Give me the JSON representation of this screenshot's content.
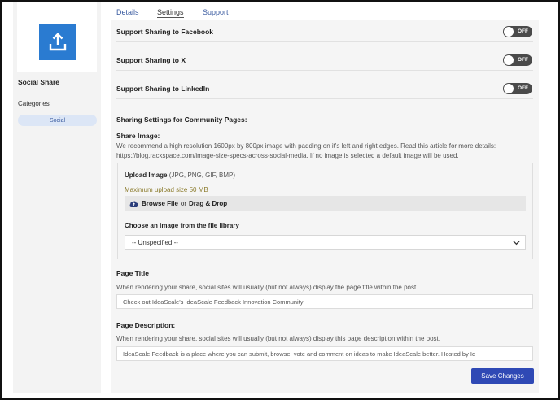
{
  "app": {
    "name": "Social Share",
    "icon": "share-upload-icon",
    "icon_color": "#2a7bd1",
    "categories_label": "Categories",
    "category_chip": "Social"
  },
  "tabs": [
    {
      "label": "Details",
      "active": false
    },
    {
      "label": "Settings",
      "active": true
    },
    {
      "label": "Support",
      "active": false
    }
  ],
  "toggles": [
    {
      "label": "Support Sharing to Facebook",
      "state": "OFF"
    },
    {
      "label": "Support Sharing to X",
      "state": "OFF"
    },
    {
      "label": "Support Sharing to LinkedIn",
      "state": "OFF"
    }
  ],
  "community": {
    "title": "Sharing Settings for Community Pages:",
    "share_image_title": "Share Image:",
    "share_image_desc_1": "We recommend a high resolution 1600px by 800px image with padding on it's left and right edges. Read this article for more details:",
    "share_image_desc_2": "https://blog.rackspace.com/image-size-specs-across-social-media. If no image is selected a default image will be used."
  },
  "upload": {
    "title": "Upload Image",
    "formats": "(JPG, PNG, GIF, BMP)",
    "max_size": "Maximum upload size 50 MB",
    "browse": "Browse File",
    "or": "or",
    "drag_drop": "Drag & Drop",
    "library_label": "Choose an image from the file library",
    "library_selected": "-- Unspecified --"
  },
  "page_title": {
    "label": "Page Title",
    "help": "When rendering your share, social sites will usually (but not always) display the page title within the post.",
    "value": "Check out IdeaScale's IdeaScale Feedback Innovation Community"
  },
  "page_description": {
    "label": "Page Description:",
    "help": "When rendering your share, social sites will usually (but not always) display this page description within the post.",
    "value": "IdeaScale Feedback is a place where you can submit, browse, vote and comment on ideas to make IdeaScale better. Hosted by Id"
  },
  "save_label": "Save Changes",
  "colors": {
    "accent": "#2f49b5",
    "toggle_off": "#4a4a4a",
    "chip_bg": "#dce6f6",
    "max_size_text": "#8a7a2a"
  }
}
